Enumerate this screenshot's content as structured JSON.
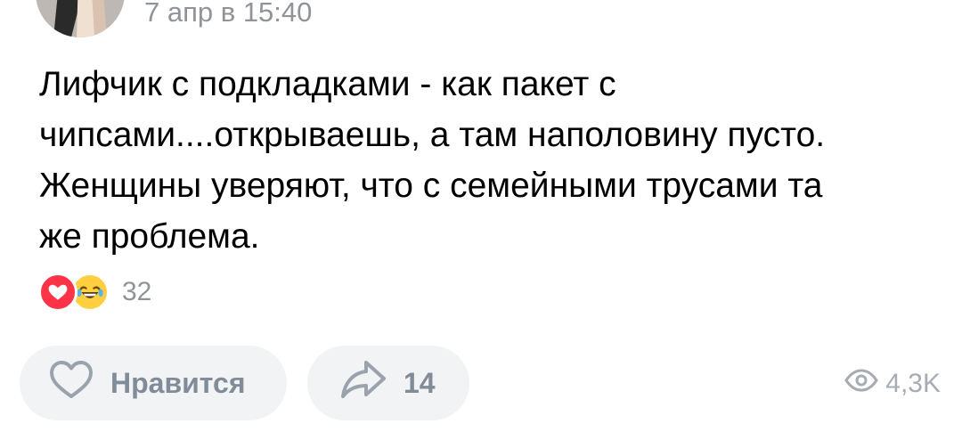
{
  "post": {
    "timestamp": "7 апр в 15:40",
    "text_lines": [
      "Лифчик с подкладками - как пакет с",
      "чипсами....открываешь, а там наполовину пусто.",
      "Женщины уверяют, что с семейными трусами та",
      "же проблема."
    ]
  },
  "reactions": {
    "icons": [
      "heart-icon",
      "laughing-tears-emoji-icon"
    ],
    "count": "32"
  },
  "actions": {
    "like_label": "Нравится",
    "like_icon": "heart-outline-icon",
    "share_count": "14",
    "share_icon": "share-arrow-icon"
  },
  "views": {
    "icon": "eye-icon",
    "count": "4,3K"
  },
  "colors": {
    "meta_gray": "#909499",
    "button_bg": "#f2f3f5",
    "button_text": "#818c99",
    "heart_red": "#ff3347",
    "emoji_yellow": "#ffcf3f"
  }
}
